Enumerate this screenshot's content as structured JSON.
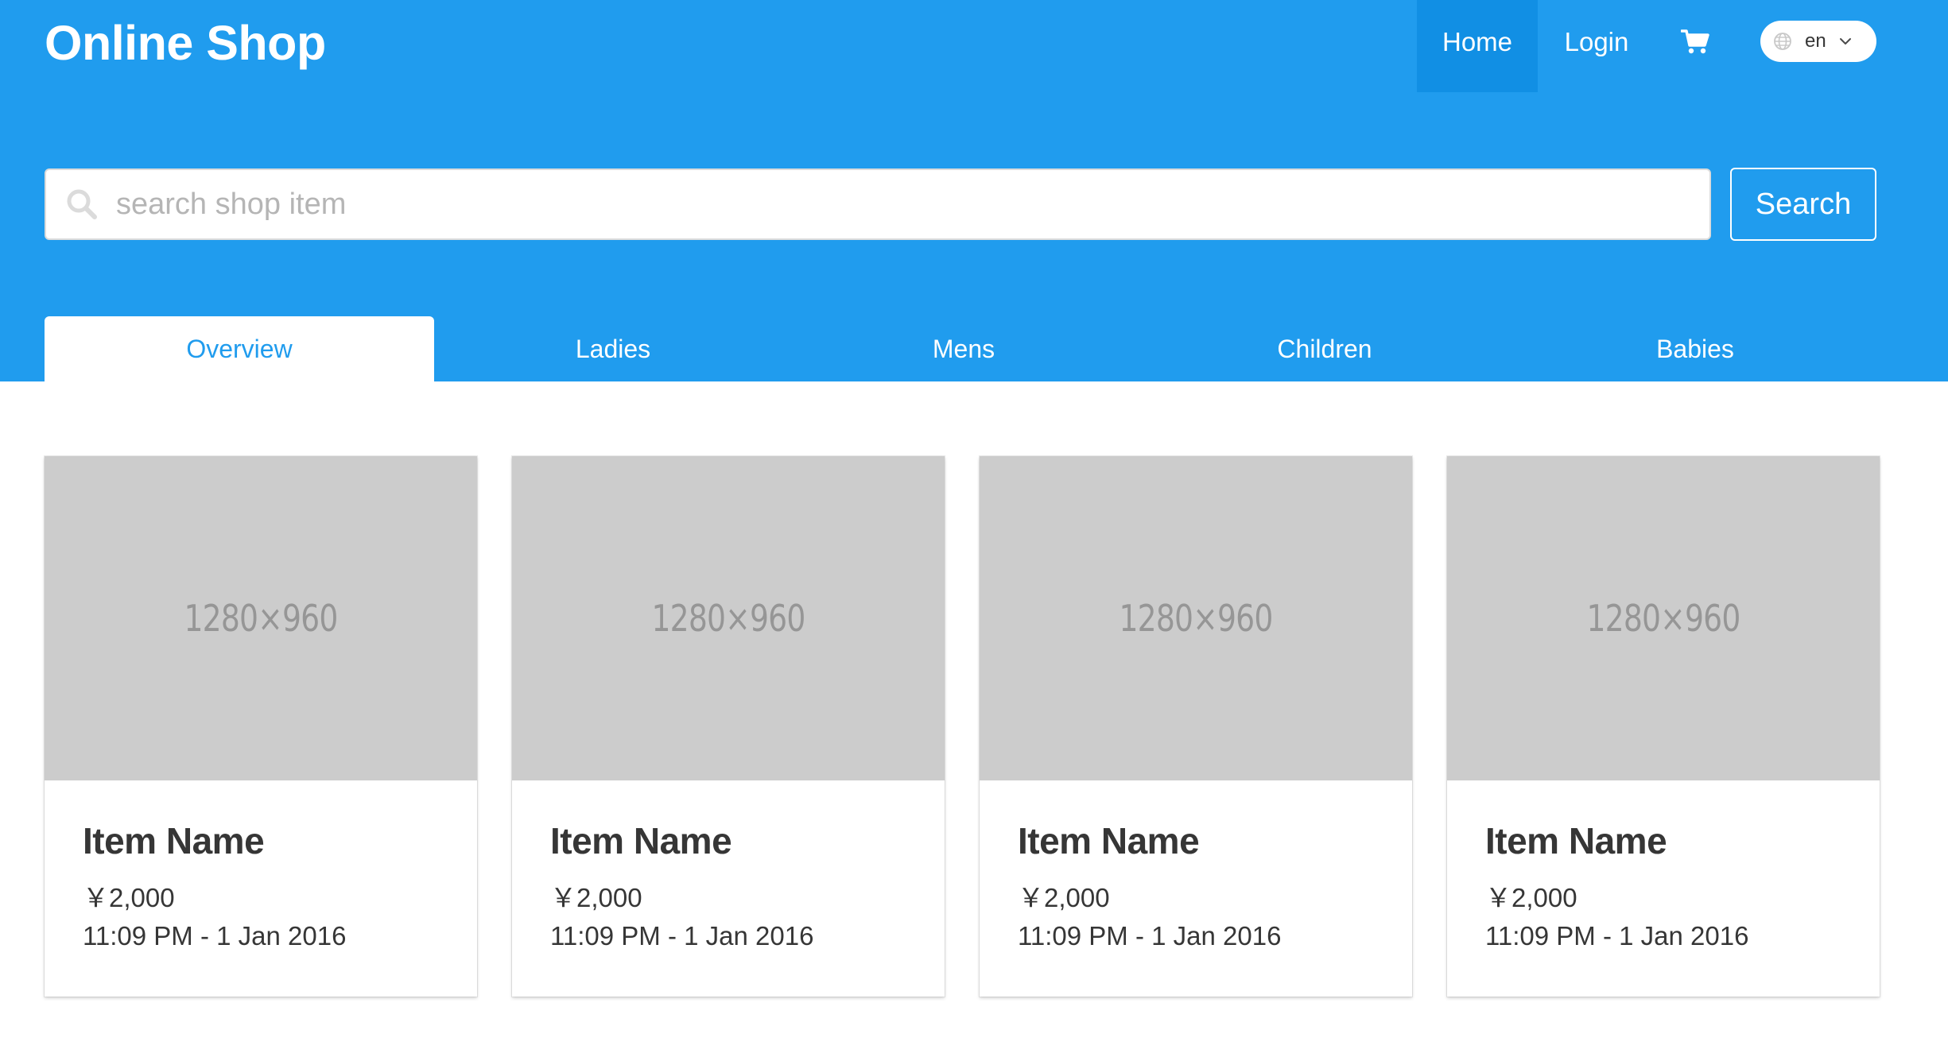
{
  "brand": {
    "title": "Online Shop"
  },
  "nav": {
    "home": "Home",
    "login": "Login",
    "cart_icon": "cart-icon",
    "language": {
      "selected": "en",
      "icon": "globe-icon"
    }
  },
  "search": {
    "placeholder": "search shop item",
    "value": "",
    "button_label": "Search"
  },
  "tabs": [
    {
      "label": "Overview",
      "active": true
    },
    {
      "label": "Ladies",
      "active": false
    },
    {
      "label": "Mens",
      "active": false
    },
    {
      "label": "Children",
      "active": false
    },
    {
      "label": "Babies",
      "active": false
    }
  ],
  "items": [
    {
      "image_text": "1280×960",
      "name": "Item Name",
      "price": "￥2,000",
      "date": "11:09 PM - 1 Jan 2016"
    },
    {
      "image_text": "1280×960",
      "name": "Item Name",
      "price": "￥2,000",
      "date": "11:09 PM - 1 Jan 2016"
    },
    {
      "image_text": "1280×960",
      "name": "Item Name",
      "price": "￥2,000",
      "date": "11:09 PM - 1 Jan 2016"
    },
    {
      "image_text": "1280×960",
      "name": "Item Name",
      "price": "￥2,000",
      "date": "11:09 PM - 1 Jan 2016"
    }
  ],
  "colors": {
    "primary": "#209cee",
    "nav_active": "#118fe4",
    "placeholder_image": "#cccccc",
    "text": "#363636"
  }
}
